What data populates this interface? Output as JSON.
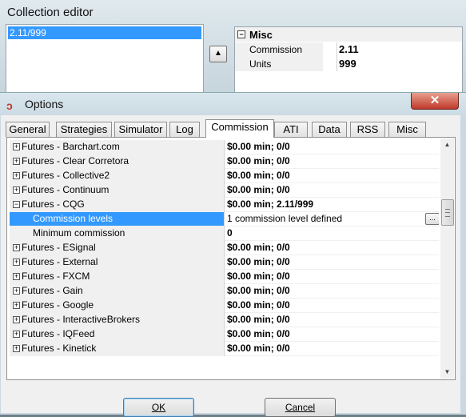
{
  "collection_editor": {
    "title": "Collection editor",
    "list_items": [
      "2.11/999"
    ],
    "move_up_glyph": "▲",
    "category": {
      "expander": "−",
      "label": "Misc"
    },
    "properties": [
      {
        "name": "Commission",
        "value": "2.11"
      },
      {
        "name": "Units",
        "value": "999"
      }
    ]
  },
  "options": {
    "title": "Options",
    "close_glyph": "✕",
    "tabs": [
      {
        "label": "General"
      },
      {
        "label": "Strategies"
      },
      {
        "label": "Simulator"
      },
      {
        "label": "Log"
      },
      {
        "label": "Commission",
        "active": true
      },
      {
        "label": "ATI"
      },
      {
        "label": "Data"
      },
      {
        "label": "RSS"
      },
      {
        "label": "Misc"
      }
    ],
    "rows": [
      {
        "expander": "+",
        "name": "Futures - Barchart.com",
        "value": "$0.00 min;  0/0"
      },
      {
        "expander": "+",
        "name": "Futures - Clear Corretora",
        "value": "$0.00 min;  0/0"
      },
      {
        "expander": "+",
        "name": "Futures - Collective2",
        "value": "$0.00 min;  0/0"
      },
      {
        "expander": "+",
        "name": "Futures - Continuum",
        "value": "$0.00 min;  0/0"
      },
      {
        "expander": "−",
        "name": "Futures - CQG",
        "value": "$0.00 min; 2.11/999"
      },
      {
        "name": "Commission levels",
        "value": "1 commission level defined",
        "child": true,
        "selected": true
      },
      {
        "name": "Minimum commission",
        "value": "0",
        "child": true
      },
      {
        "expander": "+",
        "name": "Futures - ESignal",
        "value": "$0.00 min;  0/0"
      },
      {
        "expander": "+",
        "name": "Futures - External",
        "value": "$0.00 min;  0/0"
      },
      {
        "expander": "+",
        "name": "Futures - FXCM",
        "value": "$0.00 min;  0/0"
      },
      {
        "expander": "+",
        "name": "Futures - Gain",
        "value": "$0.00 min;  0/0"
      },
      {
        "expander": "+",
        "name": "Futures - Google",
        "value": "$0.00 min;  0/0"
      },
      {
        "expander": "+",
        "name": "Futures - InteractiveBrokers",
        "value": "$0.00 min;  0/0"
      },
      {
        "expander": "+",
        "name": "Futures - IQFeed",
        "value": "$0.00 min;  0/0"
      },
      {
        "expander": "+",
        "name": "Futures - Kinetick",
        "value": "$0.00 min;  0/0"
      }
    ],
    "ellipsis_label": "...",
    "scroll_up_glyph": "▲",
    "scroll_down_glyph": "▼",
    "buttons": {
      "ok": "OK",
      "cancel": "Cancel"
    }
  }
}
